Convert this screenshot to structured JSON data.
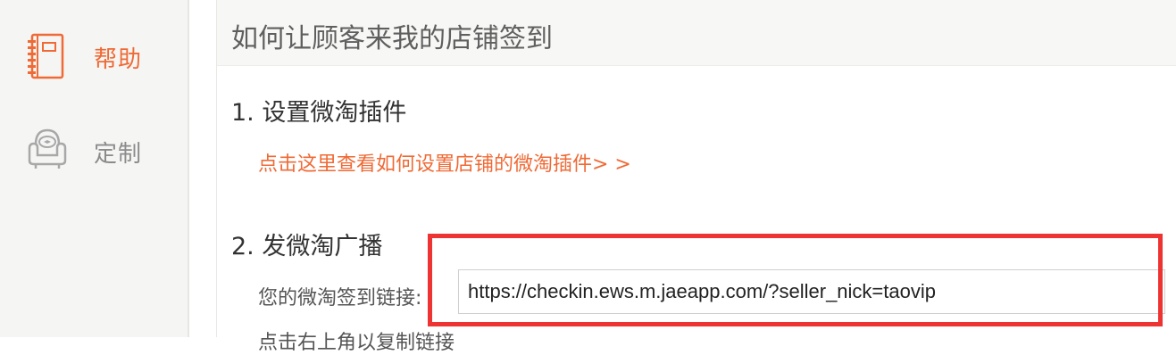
{
  "sidebar": {
    "items": [
      {
        "label": "帮助",
        "icon": "notebook-icon",
        "active": true
      },
      {
        "label": "定制",
        "icon": "armchair-icon",
        "active": false
      }
    ],
    "active_color": "#ef6a35",
    "inactive_color": "#8b8b8b"
  },
  "main": {
    "title": "如何让顾客来我的店铺签到",
    "step1": {
      "title": "1. 设置微淘插件",
      "link": "点击这里查看如何设置店铺的微淘插件> >"
    },
    "step2": {
      "title": "2. 发微淘广播",
      "field_label": "您的微淘签到链接:",
      "field_value": "https://checkin.ews.m.jaeapp.com/?seller_nick=taovip",
      "next_hint": "点击右上角以复制链接"
    }
  },
  "annotation": {
    "color": "#ee3333"
  }
}
